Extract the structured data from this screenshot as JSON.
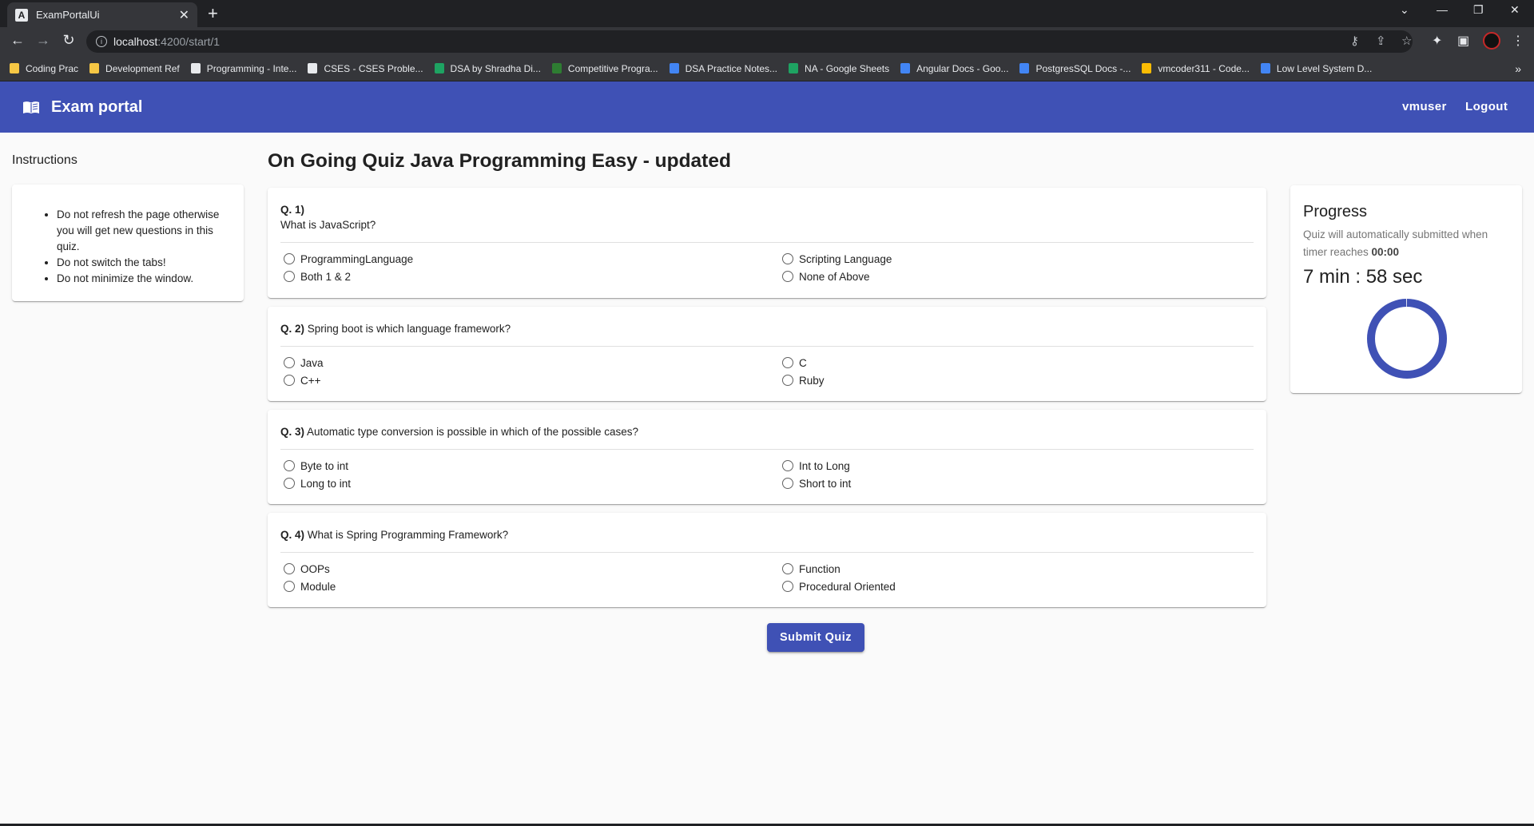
{
  "browser": {
    "tab_title": "ExamPortalUi",
    "tab_favicon": "A",
    "url_host": "localhost",
    "url_path": ":4200/start/1",
    "bookmarks": [
      {
        "label": "Coding Prac",
        "icon": "folder-icon",
        "color": "#f6c744"
      },
      {
        "label": "Development Ref",
        "icon": "folder-icon",
        "color": "#f6c744"
      },
      {
        "label": "Programming - Inte...",
        "icon": "site-icon",
        "color": "#e8eaed"
      },
      {
        "label": "CSES - CSES Proble...",
        "icon": "globe-icon",
        "color": "#e8eaed"
      },
      {
        "label": "DSA by Shradha Di...",
        "icon": "sheets-icon",
        "color": "#1ea362"
      },
      {
        "label": "Competitive Progra...",
        "icon": "site-icon",
        "color": "#2e7d32"
      },
      {
        "label": "DSA Practice Notes...",
        "icon": "docs-icon",
        "color": "#4285f4"
      },
      {
        "label": "NA - Google Sheets",
        "icon": "sheets-icon",
        "color": "#1ea362"
      },
      {
        "label": "Angular Docs - Goo...",
        "icon": "docs-icon",
        "color": "#4285f4"
      },
      {
        "label": "PostgresSQL Docs -...",
        "icon": "docs-icon",
        "color": "#4285f4"
      },
      {
        "label": "vmcoder311 - Code...",
        "icon": "chart-icon",
        "color": "#fbbc04"
      },
      {
        "label": "Low Level System D...",
        "icon": "docs-icon",
        "color": "#4285f4"
      }
    ],
    "more_bookmarks": "»"
  },
  "app": {
    "brand": "Exam portal",
    "user_link": "vmuser",
    "logout_link": "Logout",
    "primary_color": "#3f51b5"
  },
  "instructions": {
    "title": "Instructions",
    "items": [
      "Do not refresh the page otherwise you will get new questions in this quiz.",
      "Do not switch the tabs!",
      "Do not minimize the window."
    ]
  },
  "quiz": {
    "title": "On Going Quiz Java Programming Easy - updated",
    "questions": [
      {
        "number": "Q. 1)",
        "text": "What is JavaScript?",
        "options": [
          "ProgrammingLanguage",
          "Scripting Language",
          "Both 1 & 2",
          "None of Above"
        ]
      },
      {
        "number": "Q. 2)",
        "text": "Spring boot is which language framework?",
        "options": [
          "Java",
          "C",
          "C++",
          "Ruby"
        ]
      },
      {
        "number": "Q. 3)",
        "text": "Automatic type conversion is possible in which of the possible cases?",
        "options": [
          "Byte to int",
          "Int to Long",
          "Long to int",
          "Short to int"
        ]
      },
      {
        "number": "Q. 4)",
        "text": "What is Spring Programming Framework?",
        "options": [
          "OOPs",
          "Function",
          "Module",
          "Procedural Oriented"
        ]
      }
    ],
    "submit_label": "Submit Quiz"
  },
  "progress": {
    "title": "Progress",
    "subtitle": "Quiz will automatically submitted when timer reaches ",
    "subtitle_bold": "00:00",
    "timer": "7 min : 58 sec",
    "fraction_remaining": 0.995
  }
}
